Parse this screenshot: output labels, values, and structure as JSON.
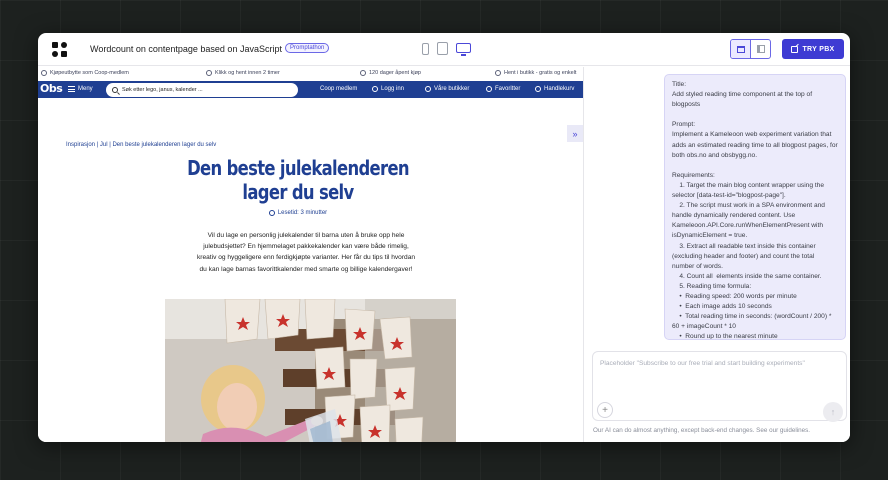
{
  "app": {
    "title": "Wordcount on contentpage based on JavaScript",
    "badge": "Promptathon",
    "devices": [
      "phone-icon",
      "tablet-icon",
      "desktop-icon"
    ],
    "try_button": "TRY PBX",
    "accent": "#3e3bd3"
  },
  "site": {
    "benefits": [
      "Kjøpeutbytte som Coop-medlem",
      "Klikk og hent innen 2 timer",
      "120 dager åpent kjøp",
      "Hent i butikk - gratis og enkelt"
    ],
    "logo": "Obs",
    "menu_label": "Meny",
    "search_placeholder": "Søk etter lego, janus, kalender ...",
    "nav": [
      "Coop medlem",
      "Logg inn",
      "Våre butikker",
      "Favoritter",
      "Handlekurv"
    ],
    "brand_color": "#1f3f92"
  },
  "article": {
    "breadcrumb": "Inspirasjon  |  Jul  |  Den beste julekalenderen lager du selv",
    "title": "Den beste julekalenderen lager du selv",
    "read_time": "Lesetid: 3 minutter",
    "intro": "Vil du lage en personlig julekalender til barna uten å bruke opp hele julebudsjettet? En hjemmelaget pakkekalender kan være både rimelig, kreativ og hyggeligere enn ferdigkjøpte varianter. Her får du tips til hvordan du kan lage barnas favorittkalender med smarte og billige kalendergaver!"
  },
  "chat": {
    "prompt_text": "Title:\nAdd styled reading time component at the top of blogposts\n\nPrompt:\nImplement a Kameleoon web experiment variation that adds an estimated reading time to all blogpost pages, for both obs.no and obsbygg.no.\n\nRequirements:\n    1. Target the main blog content wrapper using the selector [data-test-id=\"blogpost-page\"].\n    2. The script must work in a SPA environment and handle dynamically rendered content. Use Kameleoon.API.Core.runWhenElementPresent with isDynamicElement = true.\n    3. Extract all readable text inside this container (excluding header and footer) and count the total number of words.\n    4. Count all  elements inside the same container.\n    5. Reading time formula:\n    •  Reading speed: 200 words per minute\n    •  Each image adds 10 seconds\n    •  Total reading time in seconds: (wordCount / 200) * 60 + imageCount * 10\n    •  Round up to the nearest minute",
    "composer_placeholder": "Placeholder \"Subscribe to our free trial and start building experiments\"",
    "disclaimer": "Our AI can do almost anything, except back-end changes. See our guidelines."
  }
}
